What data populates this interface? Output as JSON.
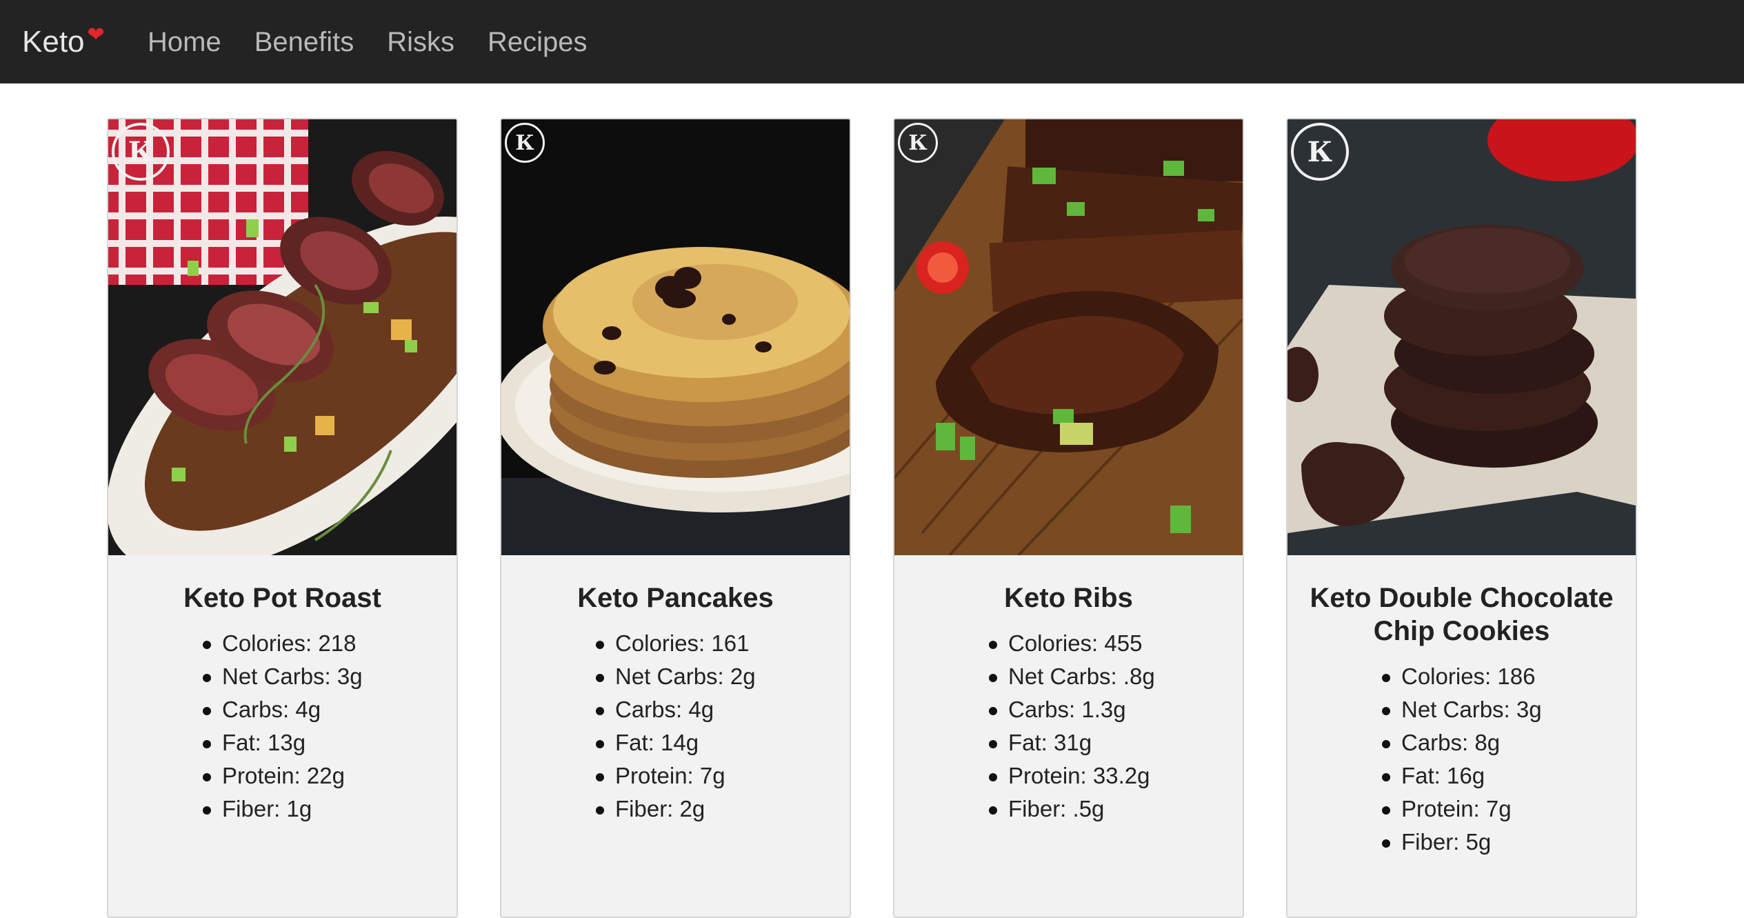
{
  "nav": {
    "brand": "Keto",
    "links": [
      "Home",
      "Benefits",
      "Risks",
      "Recipes"
    ]
  },
  "recipes": [
    {
      "title": "Keto Pot Roast",
      "macros": [
        "Colories: 218",
        "Net Carbs: 3g",
        "Carbs: 4g",
        "Fat: 13g",
        "Protein: 22g",
        "Fiber: 1g"
      ]
    },
    {
      "title": "Keto Pancakes",
      "macros": [
        "Colories: 161",
        "Net Carbs: 2g",
        "Carbs: 4g",
        "Fat: 14g",
        "Protein: 7g",
        "Fiber: 2g"
      ]
    },
    {
      "title": "Keto Ribs",
      "macros": [
        "Colories: 455",
        "Net Carbs: .8g",
        "Carbs: 1.3g",
        "Fat: 31g",
        "Protein: 33.2g",
        "Fiber: .5g"
      ]
    },
    {
      "title": "Keto Double Chocolate Chip Cookies",
      "macros": [
        "Colories: 186",
        "Net Carbs: 3g",
        "Carbs: 8g",
        "Fat: 16g",
        "Protein: 7g",
        "Fiber: 5g"
      ]
    }
  ],
  "icons": {
    "brand_heart": "heart-icon",
    "photo_watermark": "hk-logo-icon"
  },
  "colors": {
    "navbar": "#232323",
    "heart": "#e3262b",
    "card_bg": "#f2f2f2"
  }
}
